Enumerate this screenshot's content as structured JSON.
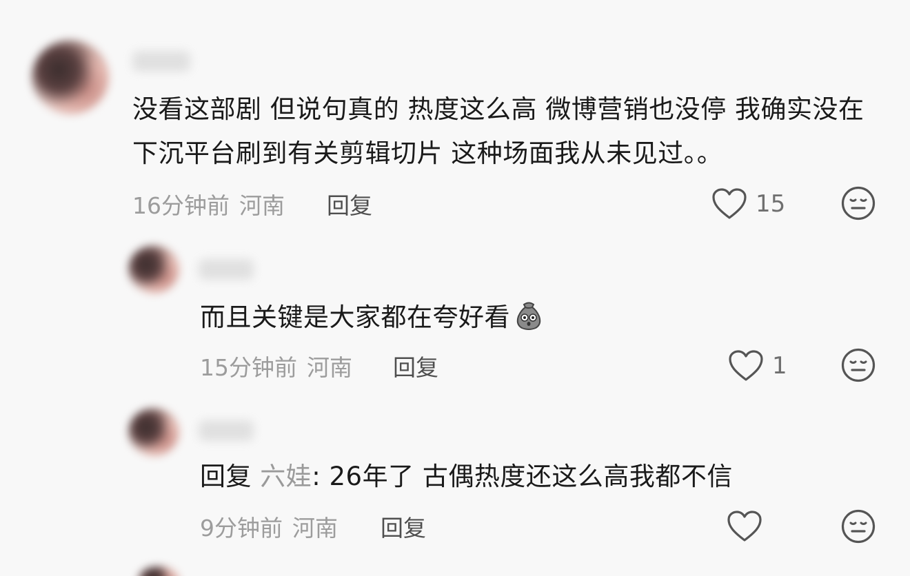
{
  "comments": [
    {
      "text": "没看这部剧 但说句真的 热度这么高 微博营销也没停 我确实没在下沉平台刷到有关剪辑切片 这种场面我从未见过。。",
      "time": "16分钟前",
      "location": "河南",
      "reply_label": "回复",
      "likes": "15"
    },
    {
      "text": "而且关键是大家都在夸好看",
      "emoji": "sack-face-emoji",
      "time": "15分钟前",
      "location": "河南",
      "reply_label": "回复",
      "likes": "1"
    },
    {
      "reply_prefix": "回复",
      "reply_target": "六娃",
      "text": ": 26年了 古偶热度还这么高我都不信",
      "time": "9分钟前",
      "location": "河南",
      "reply_label": "回复",
      "likes": ""
    }
  ],
  "colors": {
    "background": "#f8f8f8",
    "text": "#1a1a1a",
    "meta": "#9c9c9c",
    "icon": "#555555"
  },
  "icons": [
    "heart-icon",
    "meh-face-icon",
    "sack-face-emoji"
  ]
}
